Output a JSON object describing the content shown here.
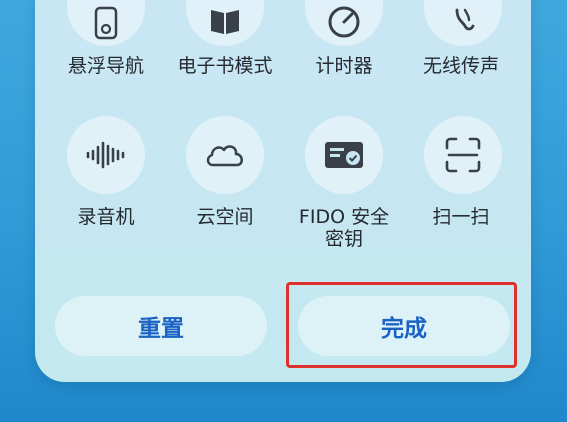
{
  "row1": [
    {
      "label": "悬浮导航",
      "icon": "floating-nav-icon"
    },
    {
      "label": "电子书模式",
      "icon": "ebook-icon"
    },
    {
      "label": "计时器",
      "icon": "timer-icon"
    },
    {
      "label": "无线传声",
      "icon": "ear-icon"
    }
  ],
  "row2": [
    {
      "label": "录音机",
      "icon": "sound-wave-icon"
    },
    {
      "label": "云空间",
      "icon": "cloud-icon"
    },
    {
      "label_line1": "FIDO 安全",
      "label_line2": "密钥",
      "icon": "security-key-icon"
    },
    {
      "label": "扫一扫",
      "icon": "scan-icon"
    }
  ],
  "buttons": {
    "reset": "重置",
    "done": "完成"
  },
  "colors": {
    "accent": "#1a63c4",
    "highlight_border": "#e0302c",
    "icon": "#3a4048"
  }
}
